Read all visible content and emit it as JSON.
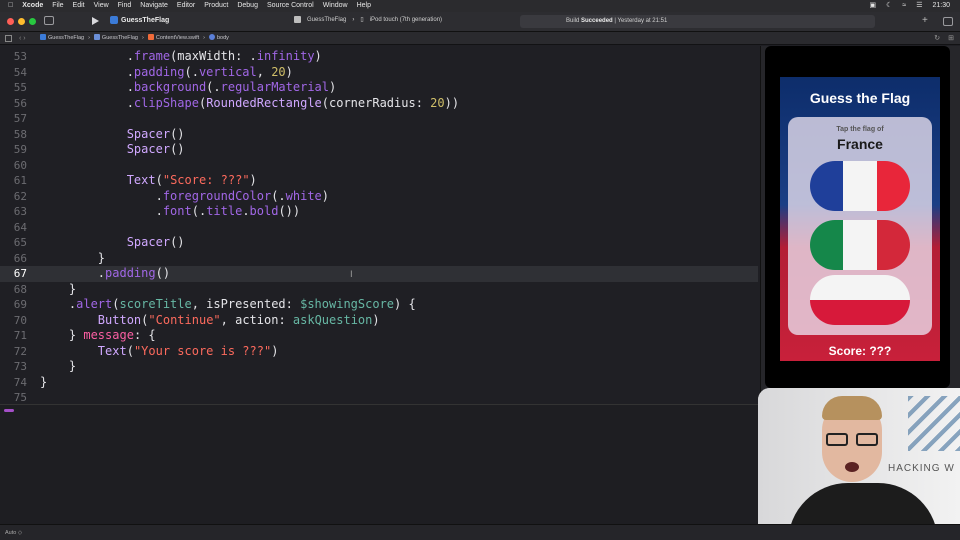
{
  "menubar": {
    "app": "Xcode",
    "items": [
      "File",
      "Edit",
      "View",
      "Find",
      "Navigate",
      "Editor",
      "Product",
      "Debug",
      "Source Control",
      "Window",
      "Help"
    ],
    "clock": "21:30"
  },
  "toolbar": {
    "project": "GuessTheFlag",
    "scheme": "GuessTheFlag",
    "device": "iPod touch (7th generation)",
    "build_prefix": "Build",
    "build_status": "Succeeded",
    "build_time": "| Yesterday at 21:51"
  },
  "jumpbar": {
    "crumbs": [
      "GuessTheFlag",
      "GuessTheFlag",
      "ContentView.swift",
      "body"
    ]
  },
  "editor": {
    "current_line": 67,
    "lines": [
      {
        "n": "53",
        "code": "            .frame(maxWidth: .infinity)"
      },
      {
        "n": "54",
        "code": "            .padding(.vertical, 20)"
      },
      {
        "n": "55",
        "code": "            .background(.regularMaterial)"
      },
      {
        "n": "56",
        "code": "            .clipShape(RoundedRectangle(cornerRadius: 20))"
      },
      {
        "n": "57",
        "code": ""
      },
      {
        "n": "58",
        "code": "            Spacer()"
      },
      {
        "n": "59",
        "code": "            Spacer()"
      },
      {
        "n": "60",
        "code": ""
      },
      {
        "n": "61",
        "code": "            Text(\"Score: ???\")"
      },
      {
        "n": "62",
        "code": "                .foregroundColor(.white)"
      },
      {
        "n": "63",
        "code": "                .font(.title.bold())"
      },
      {
        "n": "64",
        "code": ""
      },
      {
        "n": "65",
        "code": "            Spacer()"
      },
      {
        "n": "66",
        "code": "        }"
      },
      {
        "n": "67",
        "code": "        .padding()"
      },
      {
        "n": "68",
        "code": "    }"
      },
      {
        "n": "69",
        "code": "    .alert(scoreTitle, isPresented: $showingScore) {"
      },
      {
        "n": "70",
        "code": "        Button(\"Continue\", action: askQuestion)"
      },
      {
        "n": "71",
        "code": "    } message: {"
      },
      {
        "n": "72",
        "code": "        Text(\"Your score is ???\")"
      },
      {
        "n": "73",
        "code": "    }"
      },
      {
        "n": "74",
        "code": "}"
      },
      {
        "n": "75",
        "code": ""
      }
    ]
  },
  "preview": {
    "title": "Guess the Flag",
    "subtitle": "Tap the flag of",
    "country": "France",
    "score": "Score: ???",
    "flags": [
      {
        "name": "France",
        "orientation": "vertical",
        "colors": [
          "#1f3f9a",
          "#f4f4f4",
          "#e8263a"
        ]
      },
      {
        "name": "Italy",
        "orientation": "vertical",
        "colors": [
          "#15874a",
          "#f4f4f4",
          "#d3283a"
        ]
      },
      {
        "name": "Poland",
        "orientation": "horizontal",
        "colors": [
          "#f4f4f4",
          "#d7193a"
        ]
      }
    ]
  },
  "webcam": {
    "logo_text": "HACKING W"
  },
  "statusbar": {
    "mode": "Auto ◇"
  }
}
